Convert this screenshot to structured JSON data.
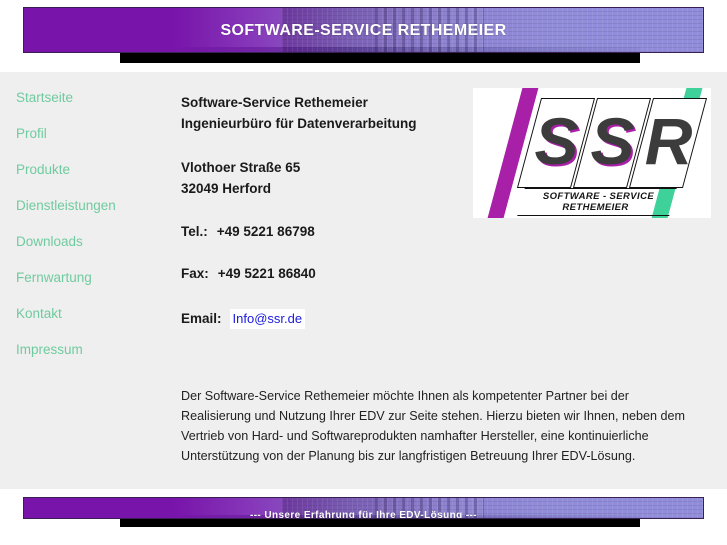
{
  "page": {
    "background_color": "#efefef"
  },
  "header": {
    "title": "SOFTWARE-SERVICE RETHEMEIER",
    "gradient_from": "#7814aa",
    "gradient_to": "#928ddb"
  },
  "sidebar": {
    "items": [
      {
        "label": "Startseite"
      },
      {
        "label": "Profil"
      },
      {
        "label": "Produkte"
      },
      {
        "label": "Dienstleistungen"
      },
      {
        "label": "Downloads"
      },
      {
        "label": "Fernwartung"
      },
      {
        "label": "Kontakt"
      },
      {
        "label": "Impressum"
      }
    ],
    "link_color": "#6fcb9f"
  },
  "main": {
    "company_name": "Software-Service Rethemeier",
    "company_subtitle": "Ingenieurbüro für Datenverarbeitung",
    "address_street": "Vlothoer Straße 65",
    "address_city": "32049 Herford",
    "phone_label": "Tel.:",
    "phone_value": "+49 5221 86798",
    "fax_label": "Fax:",
    "fax_value": "+49 5221 86840",
    "email_label": "Email:",
    "email_value": "Info@ssr.de",
    "email_link_color": "#1a1ae0",
    "intro_paragraph": "Der Software-Service Rethemeier möchte Ihnen als kompetenter Partner bei der Realisierung und Nutzung Ihrer EDV zur Seite stehen. Hierzu bieten wir Ihnen, neben dem Vertrieb von Hard- und Softwareprodukten namhafter Hersteller, eine kontinuierliche Unterstützung von der Planung bis zur langfristigen Betreuung Ihrer EDV-Lösung."
  },
  "logo": {
    "letter_1": "S",
    "letter_2": "S",
    "letter_3": "R",
    "tagline_line_1": "SOFTWARE - SERVICE",
    "tagline_line_2": "RETHEMEIER",
    "accent_left_color": "#a81fa8",
    "accent_right_color": "#3fd19a",
    "letter_color": "#3c3c3c"
  },
  "footer": {
    "slogan": "--- Unsere Erfahrung für Ihre EDV-Lösung ---"
  }
}
